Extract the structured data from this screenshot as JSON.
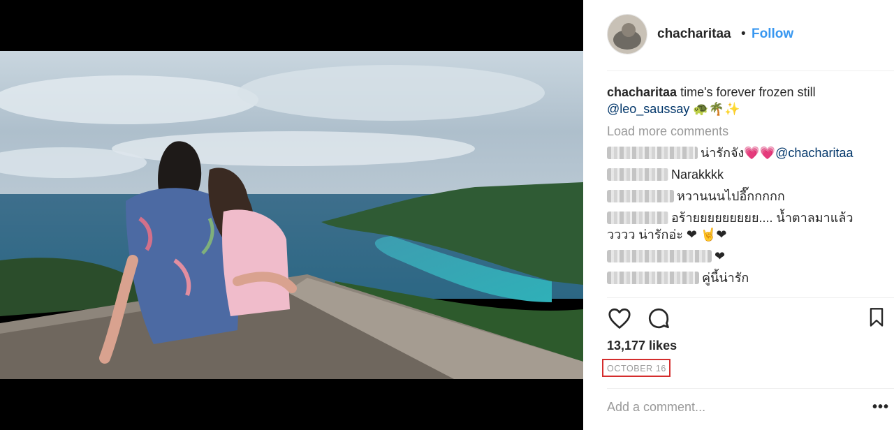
{
  "post": {
    "username": "chacharitaa",
    "follow_label": "Follow",
    "separator": "•",
    "caption_text": "time's forever frozen still",
    "caption_mention": "@leo_saussay",
    "caption_emoji": "🐢🌴✨",
    "load_more_label": "Load more comments",
    "comments": [
      {
        "text": "น่ารักจัง",
        "emoji": "💗💗",
        "mention": "@chacharitaa"
      },
      {
        "text": "Narakkkk"
      },
      {
        "text": "หวานนนไปอี๊กกกกก"
      },
      {
        "text": "อร้ายยยยยยยยย.... น้ำตาลมาแล้ว",
        "text2": "วววว น่ารักอ่ะ ❤ 🤘❤"
      },
      {
        "text": "❤"
      },
      {
        "text": "คู่นี้น่ารัก"
      }
    ],
    "likes": "13,177 likes",
    "date": "OCTOBER 16",
    "add_comment_placeholder": "Add a comment...",
    "more_label": "•••",
    "accent_color": "#3897f0",
    "highlight_color": "#d42d2d"
  },
  "icons": {
    "like": "heart-outline-icon",
    "comment": "speech-bubble-icon",
    "save": "bookmark-icon",
    "more": "ellipsis-icon"
  }
}
